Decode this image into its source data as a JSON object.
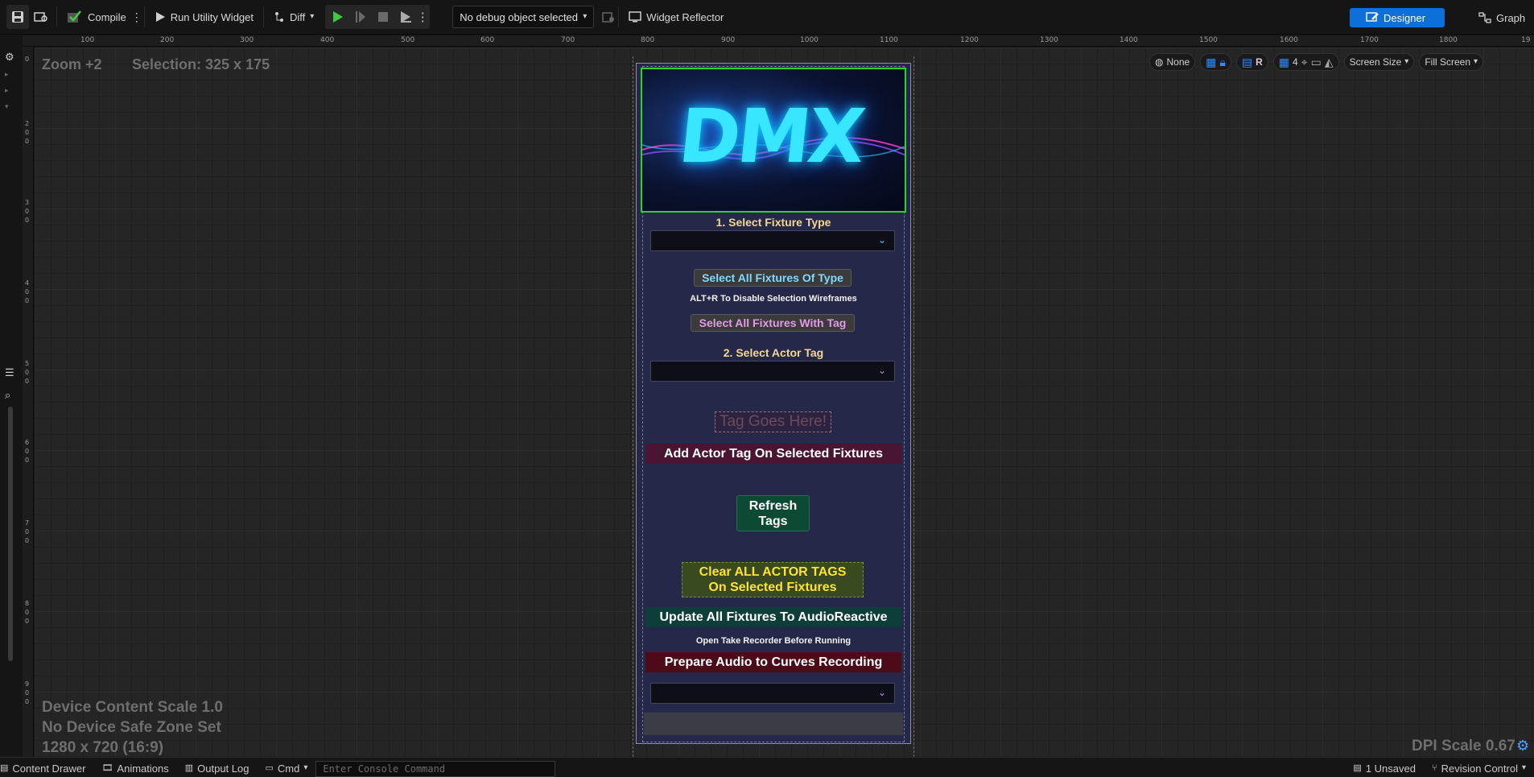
{
  "toolbar": {
    "compile_label": "Compile",
    "run_label": "Run Utility Widget",
    "diff_label": "Diff",
    "debug_select": "No debug object selected",
    "widget_reflector_label": "Widget Reflector",
    "designer_label": "Designer",
    "graph_label": "Graph"
  },
  "ruler": {
    "top_ticks": [
      "100",
      "200",
      "300",
      "400",
      "500",
      "600",
      "700",
      "800",
      "900",
      "1000",
      "1100",
      "1200",
      "1300",
      "1400",
      "1500",
      "1600",
      "1700",
      "1800",
      "19"
    ],
    "left_ticks": [
      "0",
      "200",
      "300",
      "400",
      "500",
      "600",
      "700",
      "800",
      "900"
    ]
  },
  "canvas": {
    "zoom": "Zoom +2",
    "selection": "Selection: 325 x 175",
    "device_scale": "Device Content Scale 1.0",
    "safe_zone": "No Device Safe Zone Set",
    "resolution": "1280 x 720 (16:9)",
    "dpi_scale": "DPI Scale 0.67"
  },
  "viewport_tools": {
    "none_label": "None",
    "r_label": "R",
    "grid_count": "4",
    "screen_size": "Screen Size",
    "fill_screen": "Fill Screen"
  },
  "widget": {
    "logo_text": "DMX",
    "step1_label": "1. Select Fixture Type",
    "select_type_button": "Select All Fixtures Of Type",
    "wireframe_hint": "ALT+R To Disable Selection Wireframes",
    "select_tag_button": "Select All Fixtures With Tag",
    "step2_label": "2. Select Actor Tag",
    "tag_placeholder": "Tag Goes Here!",
    "add_tag_button": "Add Actor Tag On Selected Fixtures",
    "refresh_line1": "Refresh",
    "refresh_line2": "Tags",
    "clear_line1": "Clear ALL ACTOR TAGS",
    "clear_line2": "On Selected Fixtures",
    "update_button": "Update All Fixtures To AudioReactive",
    "take_recorder_hint": "Open Take Recorder Before Running",
    "prepare_button": "Prepare Audio to Curves Recording"
  },
  "statusbar": {
    "content_drawer": "Content Drawer",
    "animations": "Animations",
    "output_log": "Output Log",
    "cmd": "Cmd",
    "console_placeholder": "Enter Console Command",
    "unsaved": "1 Unsaved",
    "revision_control": "Revision Control"
  },
  "icons": {
    "save": "save-icon",
    "browse": "browse-icon",
    "compile": "compile-check-icon",
    "play": "play-icon",
    "stop": "stop-icon",
    "settings": "gear-icon"
  },
  "colors": {
    "accent": "#0d6fd9",
    "selection_outline": "#2bd42b",
    "label_gold": "#f2d98a"
  }
}
